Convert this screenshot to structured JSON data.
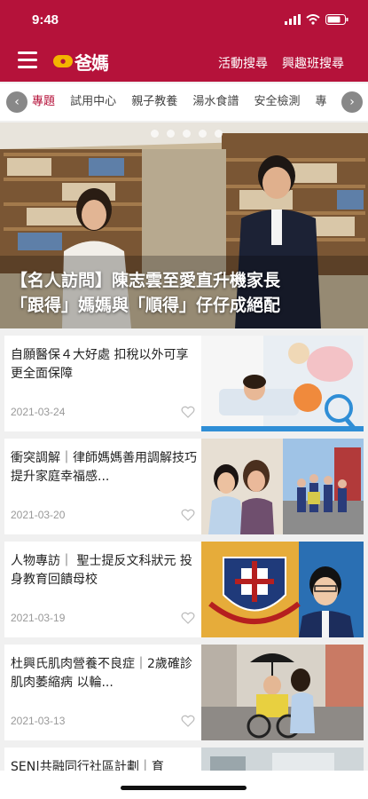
{
  "status": {
    "time": "9:48"
  },
  "header": {
    "logo_text": "爸媽",
    "links": [
      "活動搜尋",
      "興趣班搜尋"
    ]
  },
  "tabs": {
    "items": [
      "專題",
      "試用中心",
      "親子教養",
      "湯水食譜",
      "安全檢測",
      "專"
    ],
    "active_index": 0
  },
  "hero": {
    "title_line1": "【名人訪問】陳志雲至愛直升機家長",
    "title_line2": "「跟得」媽媽與「順得」仔仔成絕配",
    "dot_count": 5
  },
  "articles": [
    {
      "title": "自願醫保４大好處 扣稅以外可享更全面保障",
      "date": "2021-03-24"
    },
    {
      "title": "衝突調解｜律師媽媽善用調解技巧提升家庭幸福感...",
      "date": "2021-03-20"
    },
    {
      "title": "人物專訪｜ 聖士提反文科狀元 投身教育回饋母校",
      "date": "2021-03-19"
    },
    {
      "title": "杜興氏肌肉營養不良症｜2歲確診肌肉萎縮病 以輪...",
      "date": "2021-03-13"
    },
    {
      "title": "SEN|共融同行社區計劃｜育",
      "date": ""
    }
  ],
  "colors": {
    "brand": "#b5123a",
    "active_tab": "#b5123a"
  }
}
